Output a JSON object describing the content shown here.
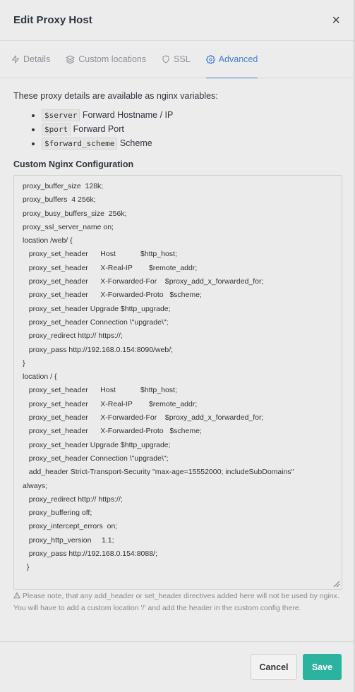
{
  "modal": {
    "title": "Edit Proxy Host",
    "close_symbol": "×"
  },
  "tabs": [
    {
      "label": "Details",
      "icon": "lightning-icon",
      "active": false
    },
    {
      "label": "Custom locations",
      "icon": "layers-icon",
      "active": false
    },
    {
      "label": "SSL",
      "icon": "shield-icon",
      "active": false
    },
    {
      "label": "Advanced",
      "icon": "gear-icon",
      "active": true
    }
  ],
  "advanced": {
    "intro": "These proxy details are available as nginx variables:",
    "variables": [
      {
        "code": "$server",
        "desc": "Forward Hostname / IP"
      },
      {
        "code": "$port",
        "desc": "Forward Port"
      },
      {
        "code": "$forward_scheme",
        "desc": "Scheme"
      }
    ],
    "config_label": "Custom Nginx Configuration",
    "config_lines": [
      "proxy_buffer_size  128k;",
      "proxy_buffers  4 256k;",
      "proxy_busy_buffers_size  256k;",
      "proxy_ssl_server_name on;",
      "location /web/ {",
      "   proxy_set_header      Host            $http_host;",
      "   proxy_set_header      X-Real-IP        $remote_addr;",
      "   proxy_set_header      X-Forwarded-For    $proxy_add_x_forwarded_for;",
      "   proxy_set_header      X-Forwarded-Proto   $scheme;",
      "   proxy_set_header Upgrade $http_upgrade;",
      "   proxy_set_header Connection \\\"upgrade\\\";",
      "   proxy_redirect http:// https://;",
      "   proxy_pass http://192.168.0.154:8090/web/;",
      "}",
      "location / {",
      "   proxy_set_header      Host            $http_host;",
      "   proxy_set_header      X-Real-IP        $remote_addr;",
      "   proxy_set_header      X-Forwarded-For    $proxy_add_x_forwarded_for;",
      "   proxy_set_header      X-Forwarded-Proto   $scheme;",
      "   proxy_set_header Upgrade $http_upgrade;",
      "   proxy_set_header Connection \\\"upgrade\\\";",
      "   add_header Strict-Transport-Security \"max-age=15552000; includeSubDomains\"",
      "always;",
      "   proxy_redirect http:// https://;",
      "   proxy_buffering off;",
      "   proxy_intercept_errors  on;",
      "   proxy_http_version     1.1;",
      "   proxy_pass http://192.168.0.154:8088/;",
      "  }"
    ],
    "note_icon": "warning-icon",
    "note": "Please note, that any add_header or set_header directives added here will not be used by nginx. You will have to add a custom location '/' and add the header in the custom config there."
  },
  "footer": {
    "cancel_label": "Cancel",
    "save_label": "Save"
  },
  "colors": {
    "accent": "#467fcf",
    "save_button": "#2bb3a0"
  }
}
